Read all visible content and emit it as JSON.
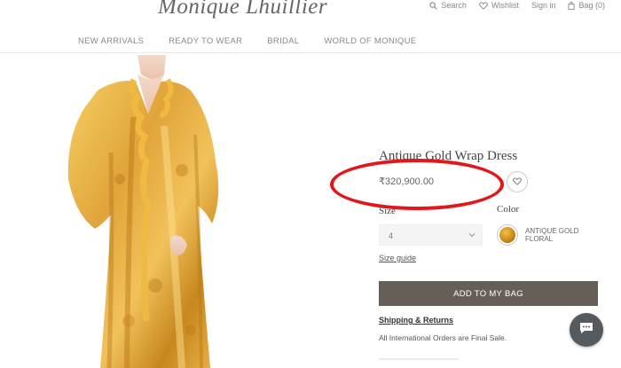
{
  "brand": {
    "logo_text": "Monique Lhuillier"
  },
  "utility": {
    "search_label": "Search",
    "wishlist_label": "Wishlist",
    "signin_label": "Sign in",
    "bag_label": "Bag (0)"
  },
  "nav": {
    "items": [
      {
        "label": "NEW ARRIVALS"
      },
      {
        "label": "READY TO WEAR"
      },
      {
        "label": "BRIDAL"
      },
      {
        "label": "WORLD OF MONIQUE"
      }
    ]
  },
  "product": {
    "title": "Antique Gold Wrap Dress",
    "price": "₹320,900.00",
    "size_label": "Size",
    "size_value": "4",
    "color_label": "Color",
    "color_name": "ANTIQUE GOLD FLORAL",
    "size_guide_label": "Size guide",
    "add_to_bag_label": "ADD TO MY BAG",
    "shipping_label": "Shipping & Returns",
    "final_sale_text": "All International Orders are Final Sale."
  },
  "colors": {
    "annotation_circle": "#e3161b",
    "button_bg": "#655f58",
    "dress_gold": "#d9a032"
  },
  "icons": [
    "search-icon",
    "heart-icon",
    "bag-icon",
    "chevron-down-icon",
    "chat-icon"
  ]
}
